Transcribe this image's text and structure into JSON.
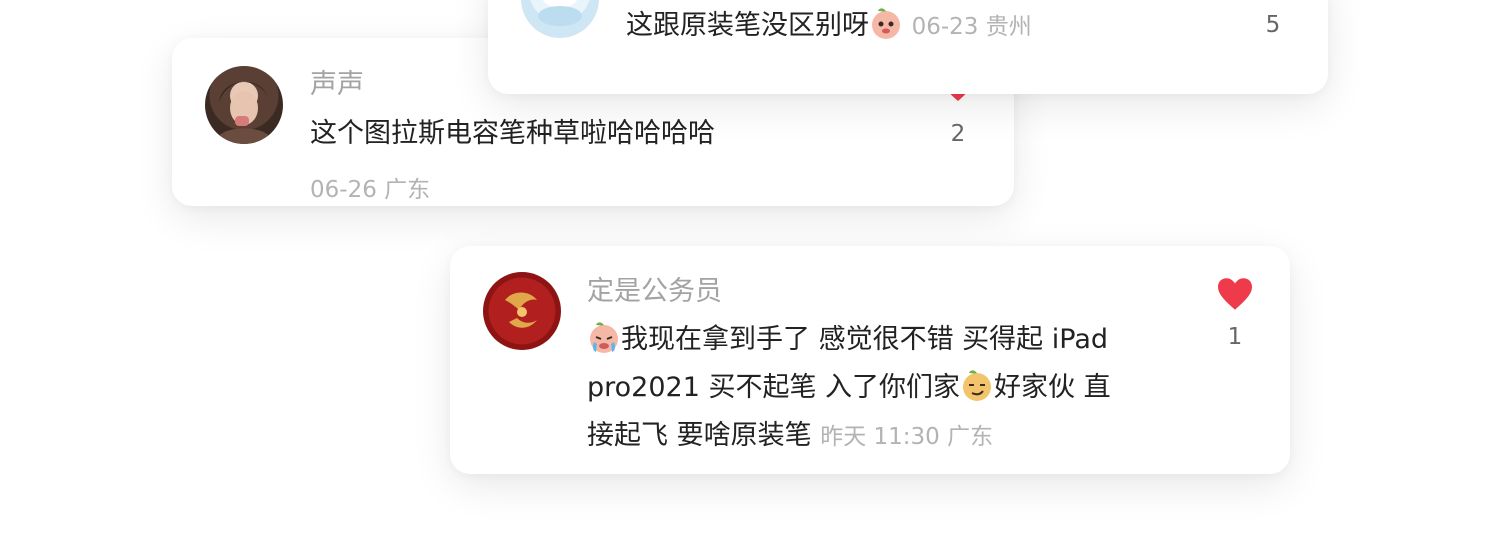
{
  "comments": [
    {
      "author": "",
      "text": "这跟原装笔没区别呀",
      "emoji_after": "peach-emoji-icon",
      "meta": "06-23 贵州",
      "likes": "5"
    },
    {
      "author": "声声",
      "text": "这个图拉斯电容笔种草啦哈哈哈哈",
      "meta": "06-26 广东",
      "likes": "2"
    },
    {
      "author": "定是公务员",
      "text_parts": [
        "我现在拿到手了 感觉很不错 买得起 iPad",
        "pro2021 买不起笔  入了你们家",
        "好家伙 直",
        "接起飞 要啥原装笔"
      ],
      "emoji_before": "crying-emoji-icon",
      "emoji_mid": "smirk-emoji-icon",
      "meta": "昨天 11:30 广东",
      "likes": "1"
    }
  ],
  "colors": {
    "accent": "#ef3a4b",
    "meta": "#b3b3b3",
    "text": "#222222"
  }
}
